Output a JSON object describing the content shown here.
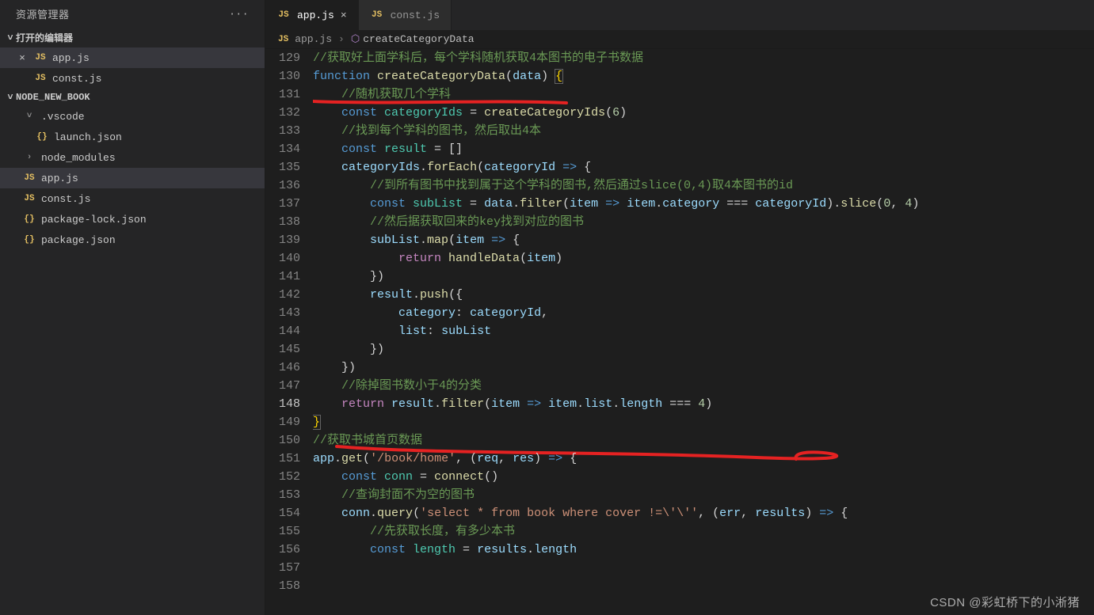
{
  "sidebar": {
    "title": "资源管理器",
    "sections": {
      "openEditors": {
        "label": "打开的编辑器",
        "items": [
          {
            "icon": "JS",
            "label": "app.js",
            "active": true,
            "close": "×"
          },
          {
            "icon": "JS",
            "label": "const.js",
            "active": false,
            "close": ""
          }
        ]
      },
      "project": {
        "label": "NODE_NEW_BOOK",
        "items": [
          {
            "kind": "folder",
            "chev": "˅",
            "label": ".vscode",
            "indent": 1
          },
          {
            "kind": "file",
            "icon": "{}",
            "label": "launch.json",
            "indent": 2
          },
          {
            "kind": "folder",
            "chev": "›",
            "label": "node_modules",
            "indent": 1
          },
          {
            "kind": "file",
            "icon": "JS",
            "label": "app.js",
            "indent": 1,
            "active": true
          },
          {
            "kind": "file",
            "icon": "JS",
            "label": "const.js",
            "indent": 1
          },
          {
            "kind": "file",
            "icon": "{}",
            "label": "package-lock.json",
            "indent": 1
          },
          {
            "kind": "file",
            "icon": "{}",
            "label": "package.json",
            "indent": 1
          }
        ]
      }
    }
  },
  "tabs": [
    {
      "icon": "JS",
      "label": "app.js",
      "active": true,
      "close": "×"
    },
    {
      "icon": "JS",
      "label": "const.js",
      "active": false,
      "close": ""
    }
  ],
  "breadcrumbs": {
    "fileIcon": "JS",
    "file": "app.js",
    "sep": "›",
    "symbolIcon": "⬡",
    "symbol": "createCategoryData"
  },
  "code": {
    "startLine": 129,
    "highlightLine": 148,
    "lines": [
      {
        "n": 129,
        "seg": [
          {
            "t": "",
            "c": "p"
          }
        ]
      },
      {
        "n": 130,
        "seg": [
          {
            "t": "//获取好上面学科后，每个学科随机获取4本图书的电子书数据",
            "c": "cmt"
          }
        ]
      },
      {
        "n": 131,
        "seg": [
          {
            "t": "function ",
            "c": "kw"
          },
          {
            "t": "createCategoryData",
            "c": "fn"
          },
          {
            "t": "(",
            "c": "p"
          },
          {
            "t": "data",
            "c": "id"
          },
          {
            "t": ") ",
            "c": "p"
          },
          {
            "t": "{",
            "c": "brace-y"
          }
        ]
      },
      {
        "n": 132,
        "seg": [
          {
            "t": "    ",
            "c": "p"
          },
          {
            "t": "//随机获取几个学科",
            "c": "cmt"
          }
        ]
      },
      {
        "n": 133,
        "seg": [
          {
            "t": "    ",
            "c": "p"
          },
          {
            "t": "const ",
            "c": "kw"
          },
          {
            "t": "categoryIds",
            "c": "c1"
          },
          {
            "t": " = ",
            "c": "p"
          },
          {
            "t": "createCategoryIds",
            "c": "fn"
          },
          {
            "t": "(",
            "c": "p"
          },
          {
            "t": "6",
            "c": "num"
          },
          {
            "t": ")",
            "c": "p"
          }
        ]
      },
      {
        "n": 134,
        "seg": [
          {
            "t": "    ",
            "c": "p"
          },
          {
            "t": "//找到每个学科的图书，然后取出4本",
            "c": "cmt"
          }
        ]
      },
      {
        "n": 135,
        "seg": [
          {
            "t": "    ",
            "c": "p"
          },
          {
            "t": "const ",
            "c": "kw"
          },
          {
            "t": "result",
            "c": "c1"
          },
          {
            "t": " = []",
            "c": "p"
          }
        ]
      },
      {
        "n": 136,
        "seg": [
          {
            "t": "    ",
            "c": "p"
          },
          {
            "t": "categoryIds",
            "c": "id"
          },
          {
            "t": ".",
            "c": "p"
          },
          {
            "t": "forEach",
            "c": "fn"
          },
          {
            "t": "(",
            "c": "p"
          },
          {
            "t": "categoryId",
            "c": "id"
          },
          {
            "t": " ",
            "c": "p"
          },
          {
            "t": "=>",
            "c": "arrow"
          },
          {
            "t": " {",
            "c": "p"
          }
        ]
      },
      {
        "n": 137,
        "seg": [
          {
            "t": "        ",
            "c": "p"
          },
          {
            "t": "//到所有图书中找到属于这个学科的图书,然后通过slice(0,4)取4本图书的id",
            "c": "cmt"
          }
        ]
      },
      {
        "n": 138,
        "seg": [
          {
            "t": "        ",
            "c": "p"
          },
          {
            "t": "const ",
            "c": "kw"
          },
          {
            "t": "subList",
            "c": "c1"
          },
          {
            "t": " = ",
            "c": "p"
          },
          {
            "t": "data",
            "c": "id"
          },
          {
            "t": ".",
            "c": "p"
          },
          {
            "t": "filter",
            "c": "fn"
          },
          {
            "t": "(",
            "c": "p"
          },
          {
            "t": "item",
            "c": "id"
          },
          {
            "t": " ",
            "c": "p"
          },
          {
            "t": "=>",
            "c": "arrow"
          },
          {
            "t": " ",
            "c": "p"
          },
          {
            "t": "item",
            "c": "id"
          },
          {
            "t": ".",
            "c": "p"
          },
          {
            "t": "category",
            "c": "id"
          },
          {
            "t": " === ",
            "c": "p"
          },
          {
            "t": "categoryId",
            "c": "id"
          },
          {
            "t": ").",
            "c": "p"
          },
          {
            "t": "slice",
            "c": "fn"
          },
          {
            "t": "(",
            "c": "p"
          },
          {
            "t": "0",
            "c": "num"
          },
          {
            "t": ", ",
            "c": "p"
          },
          {
            "t": "4",
            "c": "num"
          },
          {
            "t": ")",
            "c": "p"
          }
        ]
      },
      {
        "n": 139,
        "seg": [
          {
            "t": "        ",
            "c": "p"
          },
          {
            "t": "//然后据获取回来的key找到对应的图书",
            "c": "cmt"
          }
        ]
      },
      {
        "n": 140,
        "seg": [
          {
            "t": "        ",
            "c": "p"
          },
          {
            "t": "subList",
            "c": "id"
          },
          {
            "t": ".",
            "c": "p"
          },
          {
            "t": "map",
            "c": "fn"
          },
          {
            "t": "(",
            "c": "p"
          },
          {
            "t": "item",
            "c": "id"
          },
          {
            "t": " ",
            "c": "p"
          },
          {
            "t": "=>",
            "c": "arrow"
          },
          {
            "t": " {",
            "c": "p"
          }
        ]
      },
      {
        "n": 141,
        "seg": [
          {
            "t": "            ",
            "c": "p"
          },
          {
            "t": "return ",
            "c": "kw2"
          },
          {
            "t": "handleData",
            "c": "fn"
          },
          {
            "t": "(",
            "c": "p"
          },
          {
            "t": "item",
            "c": "id"
          },
          {
            "t": ")",
            "c": "p"
          }
        ]
      },
      {
        "n": 142,
        "seg": [
          {
            "t": "        })",
            "c": "p"
          }
        ]
      },
      {
        "n": 143,
        "seg": [
          {
            "t": "        ",
            "c": "p"
          },
          {
            "t": "result",
            "c": "id"
          },
          {
            "t": ".",
            "c": "p"
          },
          {
            "t": "push",
            "c": "fn"
          },
          {
            "t": "({",
            "c": "p"
          }
        ]
      },
      {
        "n": 144,
        "seg": [
          {
            "t": "            ",
            "c": "p"
          },
          {
            "t": "category",
            "c": "id"
          },
          {
            "t": ":",
            "c": "p"
          },
          {
            "t": " categoryId",
            "c": "id"
          },
          {
            "t": ",",
            "c": "p"
          }
        ]
      },
      {
        "n": 145,
        "seg": [
          {
            "t": "            ",
            "c": "p"
          },
          {
            "t": "list",
            "c": "id"
          },
          {
            "t": ":",
            "c": "p"
          },
          {
            "t": " subList",
            "c": "id"
          }
        ]
      },
      {
        "n": 146,
        "seg": [
          {
            "t": "        })",
            "c": "p"
          }
        ]
      },
      {
        "n": 147,
        "seg": [
          {
            "t": "    })",
            "c": "p"
          }
        ]
      },
      {
        "n": 148,
        "seg": [
          {
            "t": "    ",
            "c": "p"
          },
          {
            "t": "//除掉图书数小于4的分类",
            "c": "cmt"
          }
        ]
      },
      {
        "n": 149,
        "seg": [
          {
            "t": "    ",
            "c": "p"
          },
          {
            "t": "return ",
            "c": "kw2"
          },
          {
            "t": "result",
            "c": "id"
          },
          {
            "t": ".",
            "c": "p"
          },
          {
            "t": "filter",
            "c": "fn"
          },
          {
            "t": "(",
            "c": "p"
          },
          {
            "t": "item",
            "c": "id"
          },
          {
            "t": " ",
            "c": "p"
          },
          {
            "t": "=>",
            "c": "arrow"
          },
          {
            "t": " ",
            "c": "p"
          },
          {
            "t": "item",
            "c": "id"
          },
          {
            "t": ".",
            "c": "p"
          },
          {
            "t": "list",
            "c": "id"
          },
          {
            "t": ".",
            "c": "p"
          },
          {
            "t": "length",
            "c": "id"
          },
          {
            "t": " === ",
            "c": "p"
          },
          {
            "t": "4",
            "c": "num"
          },
          {
            "t": ")",
            "c": "p"
          }
        ]
      },
      {
        "n": 150,
        "seg": [
          {
            "t": "}",
            "c": "brace-y"
          }
        ]
      },
      {
        "n": 151,
        "seg": [
          {
            "t": "",
            "c": "p"
          }
        ]
      },
      {
        "n": 152,
        "seg": [
          {
            "t": "//获取书城首页数据",
            "c": "cmt"
          }
        ]
      },
      {
        "n": 153,
        "seg": [
          {
            "t": "app",
            "c": "id"
          },
          {
            "t": ".",
            "c": "p"
          },
          {
            "t": "get",
            "c": "fn"
          },
          {
            "t": "(",
            "c": "p"
          },
          {
            "t": "'/book/home'",
            "c": "str"
          },
          {
            "t": ", (",
            "c": "p"
          },
          {
            "t": "req",
            "c": "id"
          },
          {
            "t": ", ",
            "c": "p"
          },
          {
            "t": "res",
            "c": "id"
          },
          {
            "t": ") ",
            "c": "p"
          },
          {
            "t": "=>",
            "c": "arrow"
          },
          {
            "t": " {",
            "c": "p"
          }
        ]
      },
      {
        "n": 154,
        "seg": [
          {
            "t": "    ",
            "c": "p"
          },
          {
            "t": "const ",
            "c": "kw"
          },
          {
            "t": "conn",
            "c": "c1"
          },
          {
            "t": " = ",
            "c": "p"
          },
          {
            "t": "connect",
            "c": "fn"
          },
          {
            "t": "()",
            "c": "p"
          }
        ]
      },
      {
        "n": 155,
        "seg": [
          {
            "t": "    ",
            "c": "p"
          },
          {
            "t": "//查询封面不为空的图书",
            "c": "cmt"
          }
        ]
      },
      {
        "n": 156,
        "seg": [
          {
            "t": "    ",
            "c": "p"
          },
          {
            "t": "conn",
            "c": "id"
          },
          {
            "t": ".",
            "c": "p"
          },
          {
            "t": "query",
            "c": "fn"
          },
          {
            "t": "(",
            "c": "p"
          },
          {
            "t": "'select * from book where cover !=\\'\\''",
            "c": "str"
          },
          {
            "t": ", (",
            "c": "p"
          },
          {
            "t": "err",
            "c": "id"
          },
          {
            "t": ", ",
            "c": "p"
          },
          {
            "t": "results",
            "c": "id"
          },
          {
            "t": ") ",
            "c": "p"
          },
          {
            "t": "=>",
            "c": "arrow"
          },
          {
            "t": " {",
            "c": "p"
          }
        ]
      },
      {
        "n": 157,
        "seg": [
          {
            "t": "        ",
            "c": "p"
          },
          {
            "t": "//先获取长度，有多少本书",
            "c": "cmt"
          }
        ]
      },
      {
        "n": 158,
        "seg": [
          {
            "t": "        ",
            "c": "p"
          },
          {
            "t": "const ",
            "c": "kw"
          },
          {
            "t": "length",
            "c": "c1"
          },
          {
            "t": " = ",
            "c": "p"
          },
          {
            "t": "results",
            "c": "id"
          },
          {
            "t": ".",
            "c": "p"
          },
          {
            "t": "length",
            "c": "id"
          }
        ]
      }
    ]
  },
  "watermark": "CSDN @彩虹桥下的小淅猪"
}
